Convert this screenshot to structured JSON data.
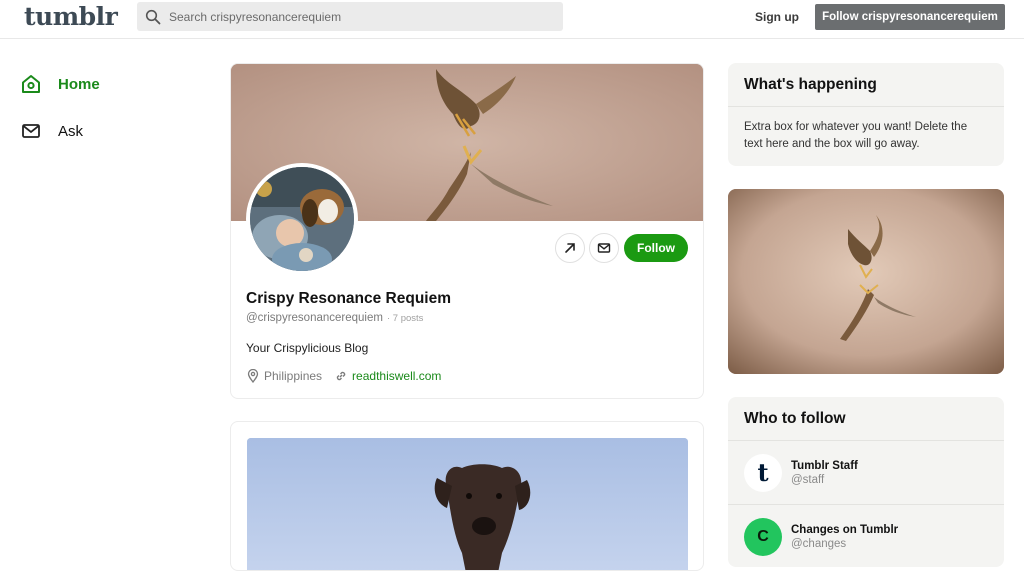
{
  "header": {
    "logo": "tumblr",
    "search_placeholder": "Search crispyresonancerequiem",
    "signup_label": "Sign up",
    "follow_label": "Follow crispyresonancerequiem"
  },
  "nav": {
    "items": [
      {
        "label": "Home",
        "icon": "home-icon",
        "active": true
      },
      {
        "label": "Ask",
        "icon": "mail-icon",
        "active": false
      }
    ]
  },
  "profile": {
    "name": "Crispy Resonance Requiem",
    "handle": "@crispyresonancerequiem",
    "posts": "· 7 posts",
    "description": "Your Crispylicious Blog",
    "location": "Philippines",
    "link": "readthiswell.com",
    "follow_label": "Follow"
  },
  "sidebar": {
    "happening_title": "What's happening",
    "happening_text": "Extra box for whatever you want! Delete the text here and the box will go away.",
    "who_title": "Who to follow",
    "who": [
      {
        "name": "Tumblr Staff",
        "handle": "@staff",
        "avatar_letter": "t",
        "avatar_bg": "#ffffff",
        "avatar_fg": "#001935"
      },
      {
        "name": "Changes on Tumblr",
        "handle": "@changes",
        "avatar_letter": "C",
        "avatar_bg": "#22c55e",
        "avatar_fg": "#0a1a0a"
      }
    ]
  },
  "colors": {
    "accent": "#1b9a12",
    "link": "#1b8a1b",
    "follow_top_bg": "#6b6e70"
  }
}
